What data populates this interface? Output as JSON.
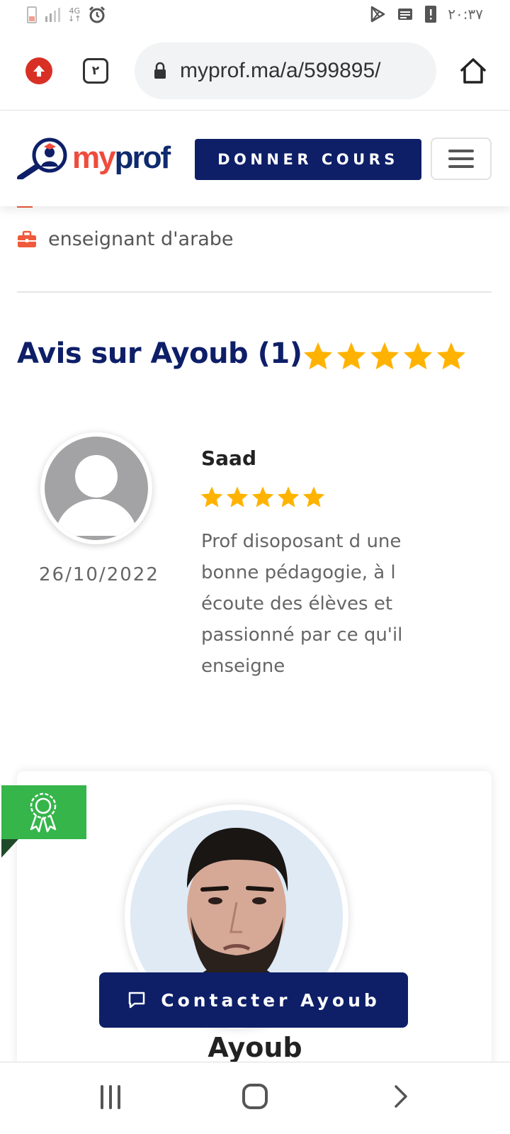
{
  "status_bar": {
    "network": "4G",
    "time": "٢٠:٣٧",
    "icons": [
      "battery-icon",
      "signal-icon",
      "alarm-icon",
      "play-store-icon",
      "news-icon",
      "alert-icon"
    ]
  },
  "browser": {
    "url": "myprof.ma/a/599895/",
    "tab_count": "٢",
    "icons": [
      "upload-icon",
      "tabs-icon",
      "lock-icon",
      "home-icon"
    ]
  },
  "header": {
    "logo_my": "my",
    "logo_prof": "prof",
    "donner_cours_label": "DONNER COURS",
    "menu_icon": "hamburger-icon"
  },
  "profile_info": {
    "job": "enseignant d'arabe",
    "job_icon": "briefcase-icon"
  },
  "reviews": {
    "title": "Avis sur Ayoub (1)",
    "rating": 5,
    "max_rating": 5,
    "items": [
      {
        "name": "Saad",
        "date": "26/10/2022",
        "rating": 5,
        "text": "Prof disoposant d une bonne pédagogie, à l écoute des élèves et passionné par ce qu'il enseigne"
      }
    ]
  },
  "profile_card": {
    "badge_icon": "award-ribbon-icon",
    "contact_label": "Contacter Ayoub",
    "contact_icon": "chat-icon",
    "name": "Ayoub"
  },
  "nav": {
    "icons": [
      "recent-apps-icon",
      "home-nav-icon",
      "back-icon"
    ]
  },
  "colors": {
    "brand_navy": "#0e1f68",
    "brand_red": "#ef4b3c",
    "star": "#ffb300",
    "badge_green": "#35b54a"
  }
}
